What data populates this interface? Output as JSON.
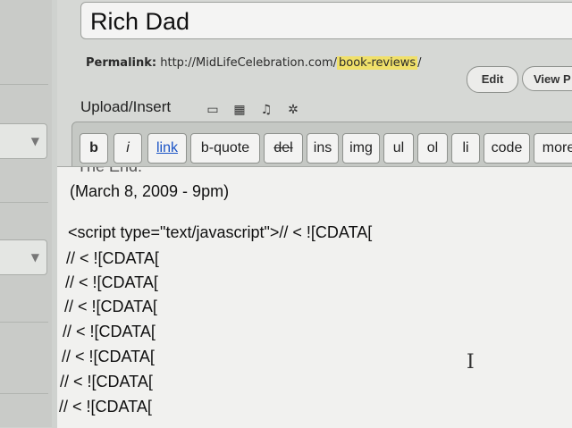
{
  "sidebar": {
    "dropdown_arrow": "▼"
  },
  "post": {
    "title": "Rich Dad"
  },
  "permalink": {
    "label": "Permalink:",
    "base_url": "http://MidLifeCelebration.com/",
    "slug": "book-reviews",
    "trailing": "/",
    "edit_label": "Edit",
    "view_label": "View P"
  },
  "upload": {
    "label": "Upload/Insert",
    "icons": [
      "image-icon",
      "video-icon",
      "audio-icon",
      "media-icon"
    ]
  },
  "toolbar": {
    "buttons": [
      "b",
      "i",
      "link",
      "b-quote",
      "del",
      "ins",
      "img",
      "ul",
      "ol",
      "li",
      "code",
      "more"
    ]
  },
  "editor": {
    "lines": [
      "The End.",
      "(March 8, 2009 - 9pm)",
      "",
      "<script type=\"text/javascript\">// < ![CDATA[",
      "// < ![CDATA[",
      "// < ![CDATA[",
      "// < ![CDATA[",
      "// < ![CDATA[",
      "// < ![CDATA[",
      "// < ![CDATA[",
      "// < ![CDATA["
    ],
    "cursor_glyph": "I"
  }
}
